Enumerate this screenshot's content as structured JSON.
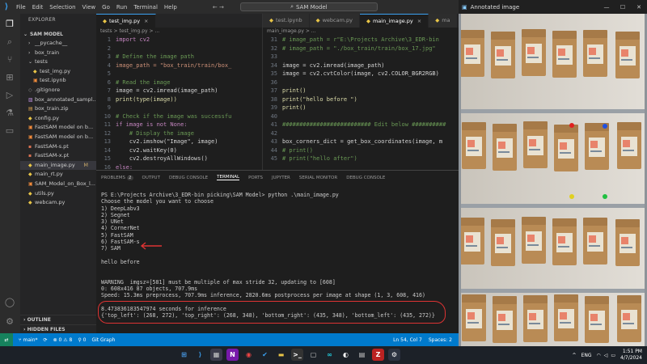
{
  "titlebar": {
    "menus": [
      "File",
      "Edit",
      "Selection",
      "View",
      "Go",
      "Run",
      "Terminal",
      "Help"
    ],
    "search": "SAM Model"
  },
  "sidebar": {
    "header": "EXPLORER",
    "root": "SAM MODEL",
    "items": [
      {
        "label": "__pycache__",
        "type": "folder",
        "indent": 1
      },
      {
        "label": "box_train",
        "type": "folder",
        "indent": 1
      },
      {
        "label": "tests",
        "type": "folder-open",
        "indent": 1
      },
      {
        "label": "test_img.py",
        "type": "py",
        "indent": 2
      },
      {
        "label": "test.ipynb",
        "type": "nb",
        "indent": 2
      },
      {
        "label": ".gitignore",
        "type": "file",
        "indent": 1
      },
      {
        "label": "box_annotated_sampl...",
        "type": "img",
        "indent": 1
      },
      {
        "label": "box_train.zip",
        "type": "zip",
        "indent": 1
      },
      {
        "label": "config.py",
        "type": "py",
        "indent": 1
      },
      {
        "label": "FastSAM model on b...",
        "type": "nb",
        "indent": 1
      },
      {
        "label": "FastSAM model on b...",
        "type": "nb",
        "indent": 1
      },
      {
        "label": "FastSAM-s.pt",
        "type": "pt",
        "indent": 1
      },
      {
        "label": "FastSAM-x.pt",
        "type": "pt",
        "indent": 1
      },
      {
        "label": "main_image.py",
        "type": "py",
        "indent": 1,
        "selected": true,
        "mark": "M"
      },
      {
        "label": "main_rt.py",
        "type": "py",
        "indent": 1
      },
      {
        "label": "SAM_Model_on_Box_l...",
        "type": "nb",
        "indent": 1
      },
      {
        "label": "utils.py",
        "type": "py",
        "indent": 1
      },
      {
        "label": "webcam.py",
        "type": "py",
        "indent": 1
      }
    ],
    "outline": "OUTLINE",
    "hidden_files": "HIDDEN FILES"
  },
  "editor_left": {
    "tabs": [
      {
        "label": "test_img.py",
        "active": true
      }
    ],
    "breadcrumb": "tests > test_img.py > ...",
    "lines": [
      {
        "n": "1",
        "t": "import cv2",
        "c": "kw"
      },
      {
        "n": "2",
        "t": "",
        "c": ""
      },
      {
        "n": "3",
        "t": "# Define the image path",
        "c": "cm"
      },
      {
        "n": "4",
        "t": "image_path = \"box_train/train/box_",
        "c": "str"
      },
      {
        "n": "5",
        "t": "",
        "c": ""
      },
      {
        "n": "6",
        "t": "# Read the image",
        "c": "cm"
      },
      {
        "n": "7",
        "t": "image = cv2.imread(image_path)",
        "c": ""
      },
      {
        "n": "8",
        "t": "print(type(image))",
        "c": "fn"
      },
      {
        "n": "9",
        "t": "",
        "c": ""
      },
      {
        "n": "10",
        "t": "# Check if the image was successfu",
        "c": "cm"
      },
      {
        "n": "11",
        "t": "if image is not None:",
        "c": "kw"
      },
      {
        "n": "12",
        "t": "    # Display the image",
        "c": "cm"
      },
      {
        "n": "13",
        "t": "    cv2.imshow(\"Image\", image)",
        "c": ""
      },
      {
        "n": "14",
        "t": "    cv2.waitKey(0)",
        "c": ""
      },
      {
        "n": "15",
        "t": "    cv2.destroyAllWindows()",
        "c": ""
      },
      {
        "n": "16",
        "t": "else:",
        "c": "kw"
      },
      {
        "n": "17",
        "t": "    print(\"Error: Unable to load i",
        "c": "fn"
      }
    ]
  },
  "editor_right": {
    "tabs": [
      {
        "label": "test.ipynb",
        "active": false
      },
      {
        "label": "webcam.py",
        "active": false
      },
      {
        "label": "main_image.py",
        "active": true
      },
      {
        "label": "ma",
        "active": false
      }
    ],
    "breadcrumb": "main_image.py > ...",
    "lines": [
      {
        "n": "31",
        "t": "# image_path = r\"E:\\Projects Archive\\3_EDR-bin",
        "c": "cm"
      },
      {
        "n": "32",
        "t": "# image_path = \"./box_train/train/box_17.jpg\"",
        "c": "cm"
      },
      {
        "n": "33",
        "t": "",
        "c": ""
      },
      {
        "n": "34",
        "t": "image = cv2.imread(image_path)",
        "c": ""
      },
      {
        "n": "35",
        "t": "image = cv2.cvtColor(image, cv2.COLOR_BGR2RGB)",
        "c": ""
      },
      {
        "n": "36",
        "t": "",
        "c": ""
      },
      {
        "n": "37",
        "t": "print()",
        "c": "fn"
      },
      {
        "n": "38",
        "t": "print(\"hello before \")",
        "c": "fn"
      },
      {
        "n": "39",
        "t": "print()",
        "c": "fn"
      },
      {
        "n": "40",
        "t": "",
        "c": ""
      },
      {
        "n": "41",
        "t": "########################## Edit below ##########",
        "c": "cm"
      },
      {
        "n": "42",
        "t": "",
        "c": ""
      },
      {
        "n": "43",
        "t": "box_corners_dict = get_box_coordinates(image, m",
        "c": ""
      },
      {
        "n": "44",
        "t": "# print()",
        "c": "cm"
      },
      {
        "n": "45",
        "t": "# print(\"hello after\")",
        "c": "cm"
      }
    ]
  },
  "panel": {
    "tabs": [
      {
        "label": "PROBLEMS",
        "badge": "2"
      },
      {
        "label": "OUTPUT"
      },
      {
        "label": "DEBUG CONSOLE"
      },
      {
        "label": "TERMINAL",
        "active": true
      },
      {
        "label": "PORTS"
      },
      {
        "label": "JUPYTER"
      },
      {
        "label": "SERIAL MONITOR"
      },
      {
        "label": "DEBUG CONSOLE"
      }
    ],
    "terminal_lines": [
      "PS E:\\Projects Archive\\3_EDR-bin picking\\SAM Model> python .\\main_image.py",
      "Choose the model you want to choose",
      "1) DeepLabv3",
      "2) Segnet",
      "3) UNet",
      "4) CornerNet",
      "5) FastSAM",
      "6) FastSAM-s",
      "7) SAM",
      "",
      "hello before",
      "",
      "",
      "WARNING  imgsz=[581] must be multiple of max stride 32, updating to [608]",
      "0: 608x416 87 objects, 707.9ms",
      "Speed: 15.3ms preprocess, 707.9ms inference, 2820.6ms postprocess per image at shape (1, 3, 608, 416)",
      "",
      "8.473836183547974 seconds for inference",
      "{'top_left': (268, 272), 'top_right': (268, 348), 'bottom_right': (435, 348), 'bottom_left': (435, 272)}"
    ]
  },
  "statusbar": {
    "branch": "main*",
    "sync": "⟳",
    "problems": "⊗ 0  ⚠ 8",
    "ports": "⚲ 0",
    "git_graph": "Git Graph",
    "position": "Ln 54, Col 7",
    "spaces": "Spaces: 2"
  },
  "image_window": {
    "title": "Annotated image"
  },
  "taskbar": {
    "lang": "ENG",
    "time": "1:51 PM",
    "date": "4/7/2024"
  },
  "colors": {
    "accent": "#007acc",
    "annotation": "#dd3333"
  }
}
